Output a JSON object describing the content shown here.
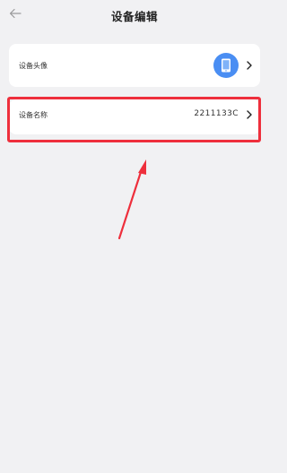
{
  "header": {
    "title": "设备编辑",
    "back_icon": "arrow-left-icon"
  },
  "avatar_row": {
    "label": "设备头像",
    "avatar_icon": "phone-icon",
    "avatar_color": "#4a8ef3",
    "chevron_icon": "chevron-right-icon"
  },
  "name_row": {
    "label": "设备名称",
    "value": "2211133C",
    "chevron_icon": "chevron-right-icon"
  },
  "annotation": {
    "highlight_color": "#ee2f3c",
    "arrow_icon": "annotation-arrow-icon"
  },
  "colors": {
    "background": "#f1f1f3",
    "card": "#ffffff",
    "accent": "#4a8ef3"
  }
}
